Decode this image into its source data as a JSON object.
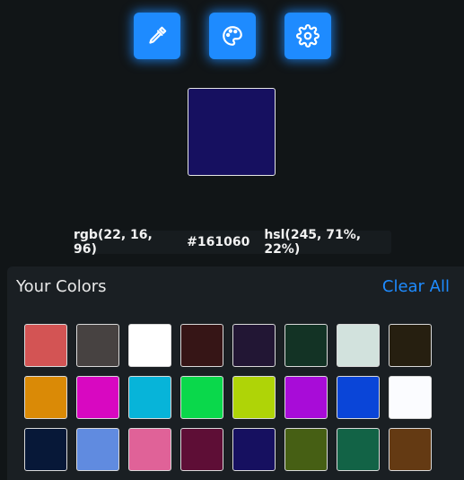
{
  "toolbar": {
    "icons": [
      "eyedropper-icon",
      "palette-icon",
      "gear-icon"
    ],
    "accent": "#1e8bff"
  },
  "current_color": "#161060",
  "values": {
    "rgb": "rgb(22, 16, 96)",
    "hex": "#161060",
    "hsl": "hsl(245, 71%, 22%)"
  },
  "saved": {
    "title": "Your Colors",
    "clear_label": "Clear All",
    "swatches": [
      "#d35454",
      "#474241",
      "#ffffff",
      "#361516",
      "#221634",
      "#133325",
      "#d2e2dd",
      "#261f10",
      "#da8a06",
      "#d808c1",
      "#07b4d9",
      "#0ad84b",
      "#afd407",
      "#a80cd8",
      "#0a45d8",
      "#fbfcff",
      "#071838",
      "#608be0",
      "#e06298",
      "#5e0e36",
      "#161060",
      "#465f14",
      "#126346",
      "#643a13"
    ]
  }
}
